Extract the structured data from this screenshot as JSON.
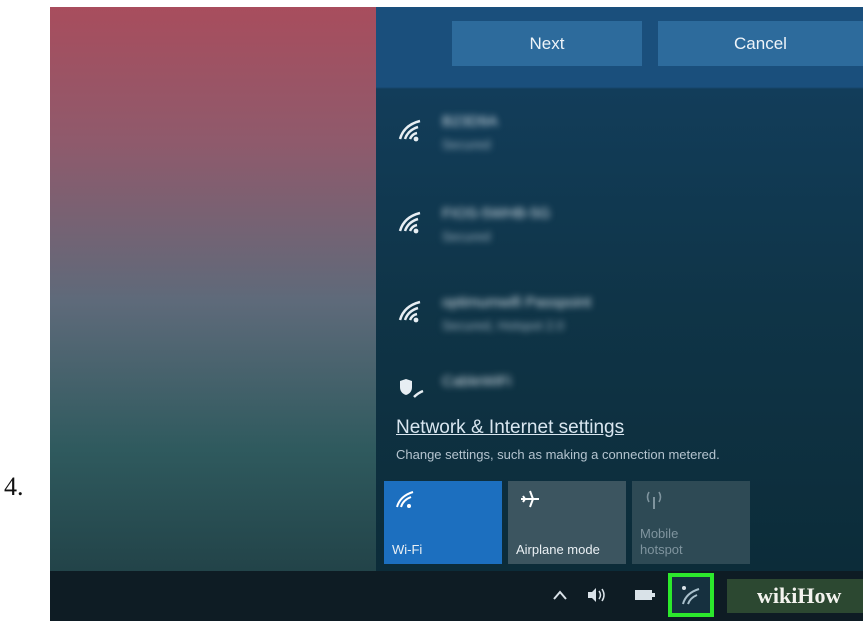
{
  "step_number": "4.",
  "dialog": {
    "next_label": "Next",
    "cancel_label": "Cancel"
  },
  "networks": [
    {
      "name": "B23D9A",
      "status": "Secured",
      "icon": "wifi-icon"
    },
    {
      "name": "FIOS-5WHB-5G",
      "status": "Secured",
      "icon": "wifi-icon"
    },
    {
      "name": "optimumwifi Passpoint",
      "status": "Secured, Hotspot 2.0",
      "icon": "wifi-icon"
    },
    {
      "name": "CableWiFi",
      "status": "",
      "icon": "wifi-shield-icon"
    }
  ],
  "settings": {
    "link_label": "Network & Internet settings",
    "description": "Change settings, such as making a connection metered."
  },
  "quick_actions": [
    {
      "label": "Wi-Fi",
      "icon": "wifi-icon",
      "state": "on"
    },
    {
      "label": "Airplane mode",
      "icon": "airplane-icon",
      "state": "off"
    },
    {
      "label": "Mobile hotspot",
      "icon": "hotspot-icon",
      "state": "disabled"
    }
  ],
  "taskbar": {
    "icons": [
      "chevron-up-icon",
      "volume-icon",
      "battery-icon",
      "network-icon"
    ]
  },
  "watermark": "wikiHow",
  "colors": {
    "panel": "#123d5a",
    "button": "#2d6b9c",
    "wifi_tile_active": "#1c6fbf",
    "highlight": "#2ce82c",
    "taskbar": "#0e1c24"
  }
}
